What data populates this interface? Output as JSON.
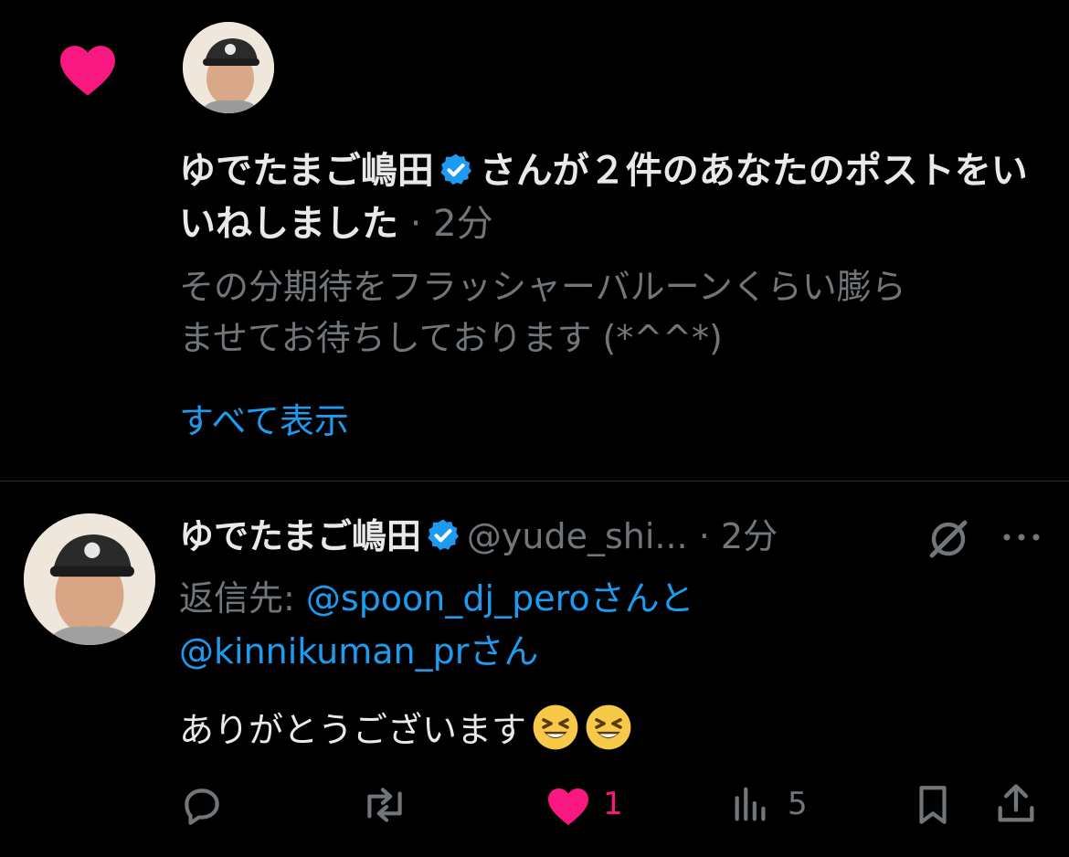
{
  "notification": {
    "user_name": "ゆでたまご嶋田",
    "action_text": "さんが２件のあなたのポストをいいねしました",
    "separator": "·",
    "time": "2分",
    "preview_line1": "その分期待をフラッシャーバルーンくらい膨ら",
    "preview_line2": "ませてお待ちしております (*^^*)",
    "show_all_label": "すべて表示"
  },
  "post": {
    "name": "ゆでたまご嶋田",
    "handle": "@yude_shi...",
    "separator": "·",
    "time": "2分",
    "replying_label": "返信先: ",
    "mention1": "@spoon_dj_pero",
    "joiner": "さんと",
    "mention2": "@kinnikuman_pr",
    "suffix": "さん",
    "text": "ありがとうございます",
    "emojis": [
      "laughing-face",
      "laughing-face"
    ],
    "actions": {
      "reply_count": "",
      "repost_count": "",
      "like_count": "1",
      "views_count": "5"
    }
  },
  "colors": {
    "background": "#000000",
    "like_pink": "#f91880",
    "link_blue": "#1d9bf0",
    "muted_gray": "#71767b",
    "text": "#e7e9ea"
  },
  "icons": [
    "heart-icon",
    "verified-badge-icon",
    "grok-icon",
    "more-icon",
    "reply-icon",
    "repost-icon",
    "like-icon",
    "views-icon",
    "bookmark-icon",
    "share-icon"
  ]
}
